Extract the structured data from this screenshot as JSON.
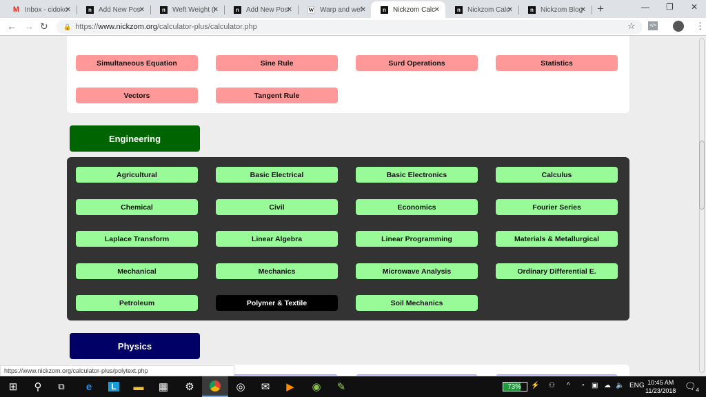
{
  "browser": {
    "tabs": [
      {
        "title": "Inbox - cidoko",
        "icon": "gmail-icon"
      },
      {
        "title": "Add New Post",
        "icon": "nickzom-icon"
      },
      {
        "title": "Weft Weight (F",
        "icon": "nickzom-icon"
      },
      {
        "title": "Add New Post",
        "icon": "nickzom-icon"
      },
      {
        "title": "Warp and weft",
        "icon": "wikipedia-icon"
      },
      {
        "title": "Nickzom Calcu",
        "icon": "nickzom-icon",
        "active": true
      },
      {
        "title": "Nickzom Calcu",
        "icon": "nickzom-icon"
      },
      {
        "title": "Nickzom Blog",
        "icon": "nickzom-icon"
      }
    ],
    "new_tab": "+",
    "window": {
      "minimize": "—",
      "restore": "❐",
      "close": "✕"
    },
    "url_prefix": "https://",
    "url_host": "www.nickzom.org",
    "url_path": "/calculator-plus/calculator.php",
    "status_url": "https://www.nickzom.org/calculator-plus/polytext.php"
  },
  "math_section": {
    "buttons": [
      "Simultaneous Equation",
      "Sine Rule",
      "Surd Operations",
      "Statistics",
      "Vectors",
      "Tangent Rule"
    ]
  },
  "engineering": {
    "title": "Engineering",
    "color": "#006400",
    "buttons": [
      "Agricultural",
      "Basic Electrical",
      "Basic Electronics",
      "Calculus",
      "Chemical",
      "Civil",
      "Economics",
      "Fourier Series",
      "Laplace Transform",
      "Linear Algebra",
      "Linear Programming",
      "Materials & Metallurgical",
      "Mechanical",
      "Mechanics",
      "Microwave Analysis",
      "Ordinary Differential E.",
      "Petroleum",
      "Polymer & Textile",
      "Soil Mechanics"
    ],
    "selected": "Polymer & Textile"
  },
  "physics": {
    "title": "Physics",
    "color": "#000066"
  },
  "taskbar": {
    "battery": "73%",
    "language": "ENG",
    "time": "10:45 AM",
    "date": "11/23/2018",
    "notifications": "4"
  }
}
